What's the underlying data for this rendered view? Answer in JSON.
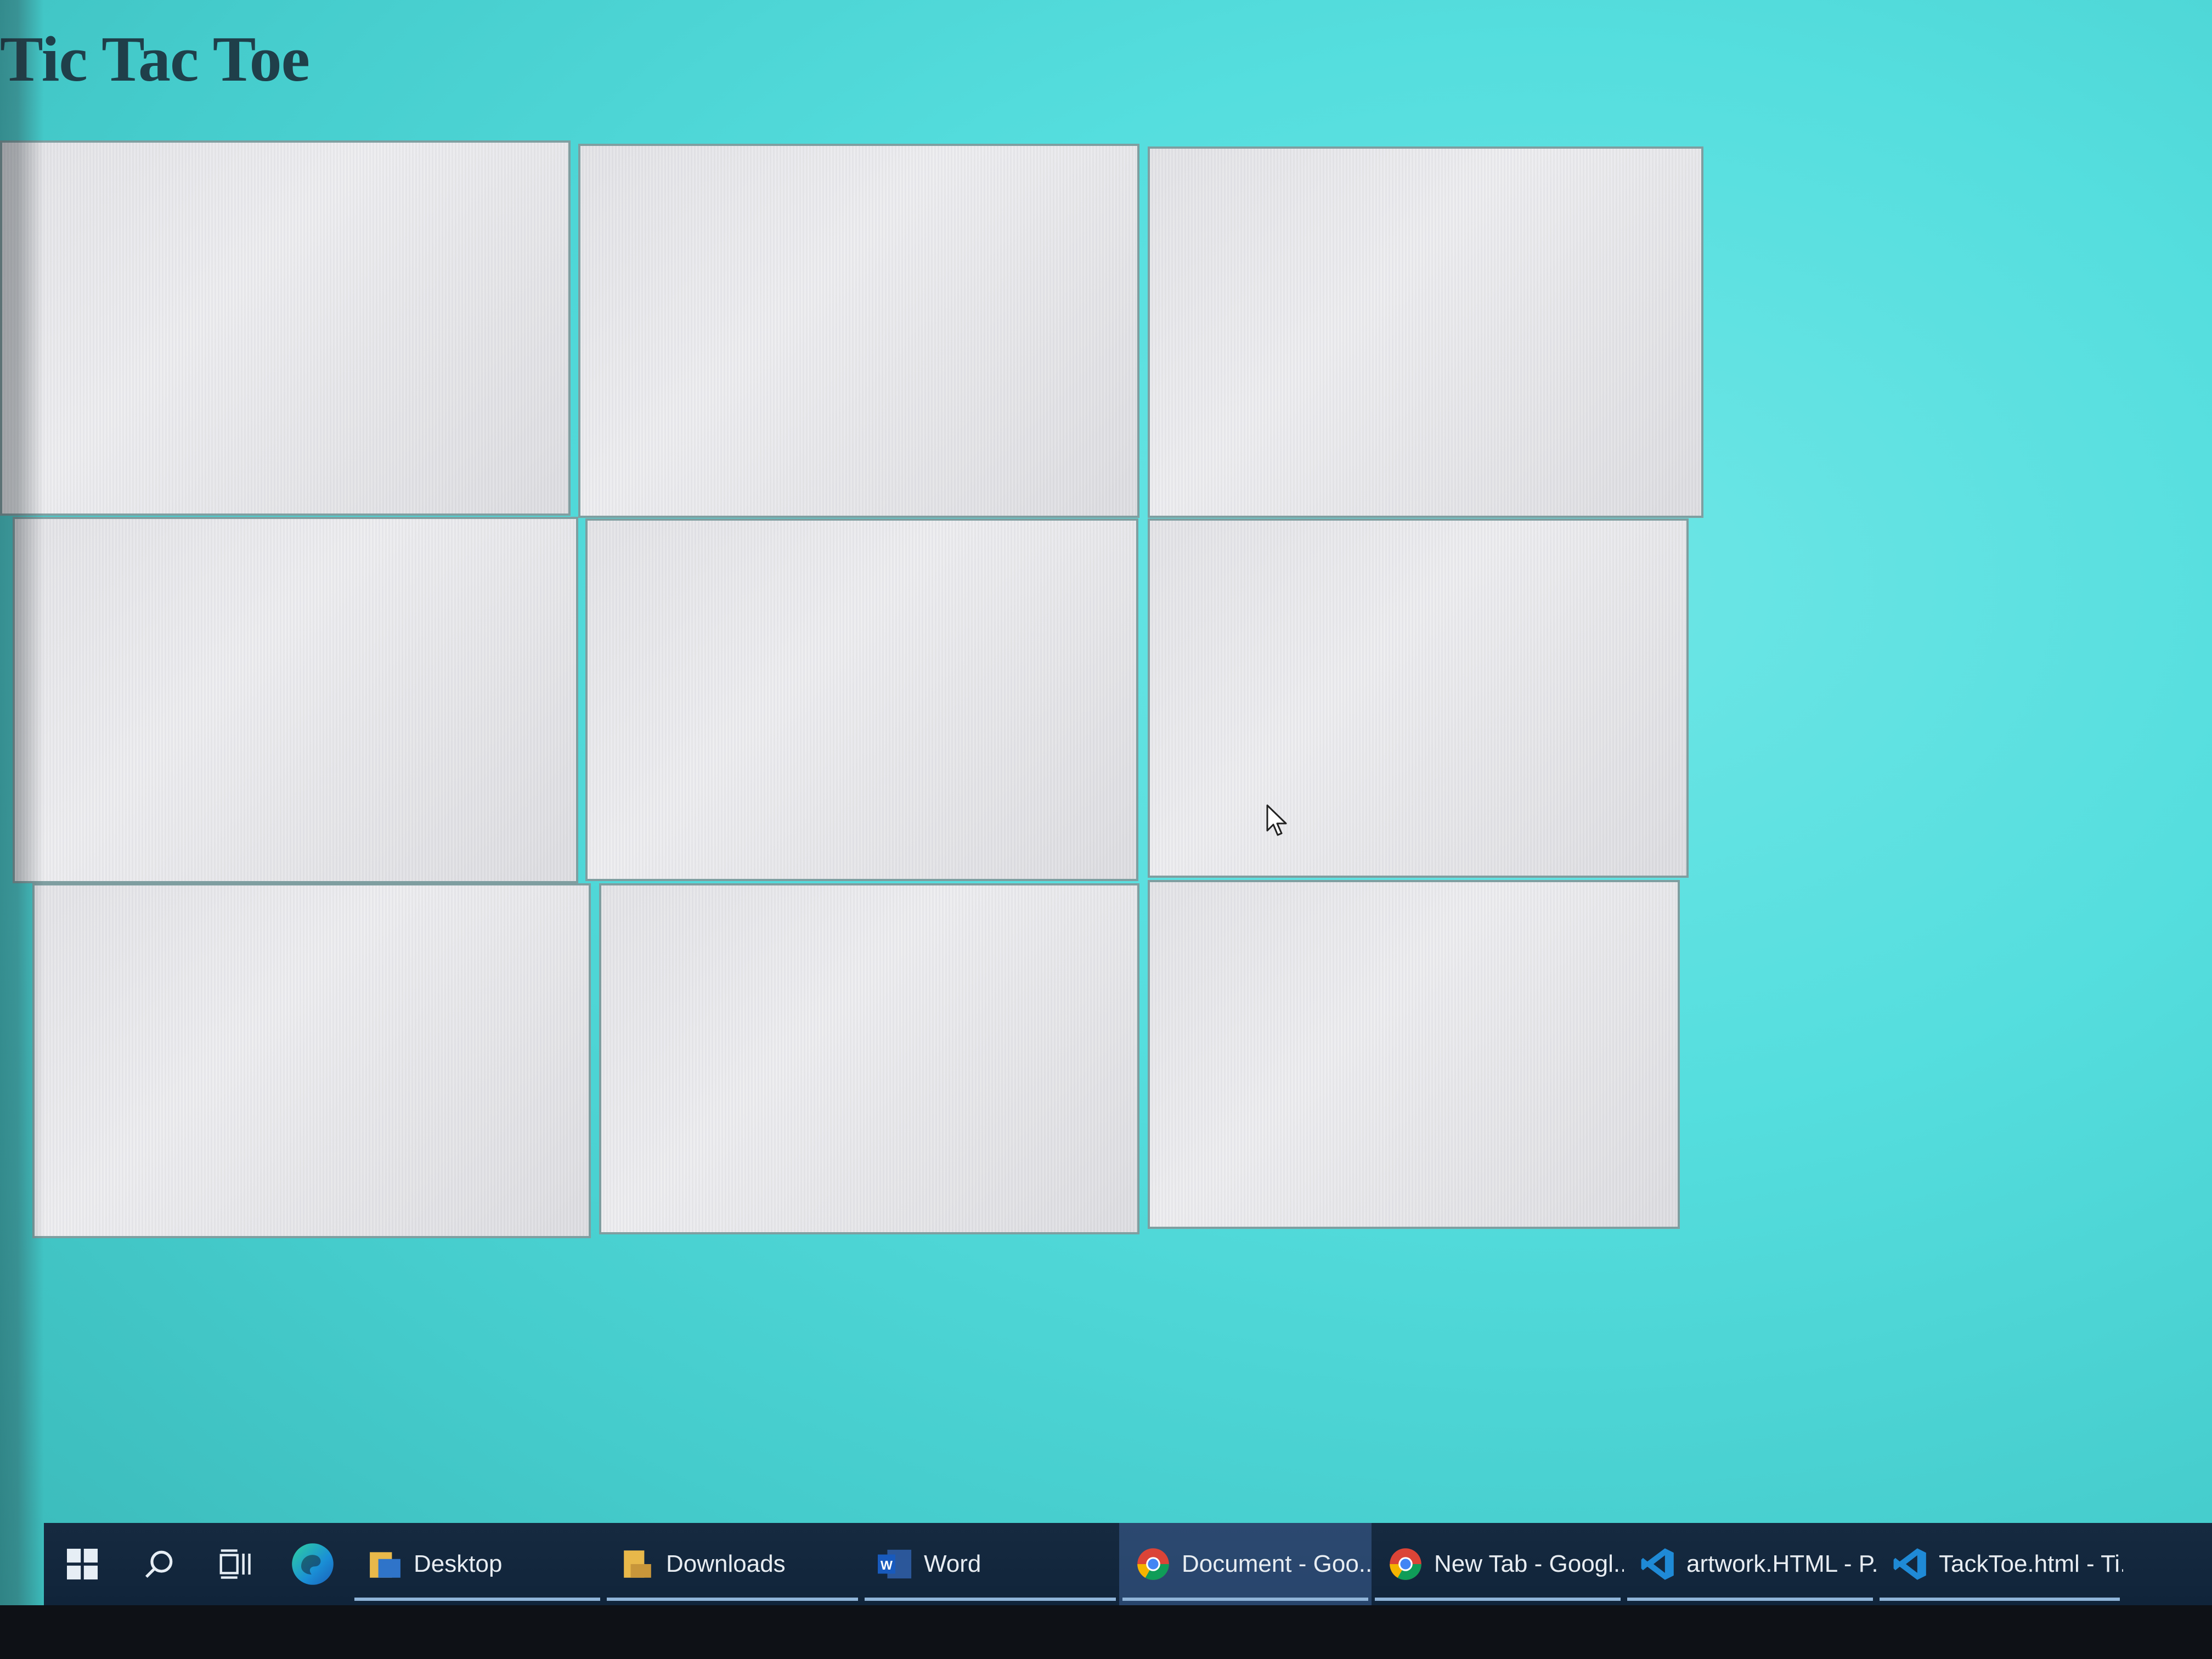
{
  "page": {
    "title": "Tic Tac Toe"
  },
  "board": {
    "cells": [
      "",
      "",
      "",
      "",
      "",
      "",
      "",
      "",
      ""
    ]
  },
  "taskbar": {
    "icons": [
      "windows-start-icon",
      "search-icon",
      "task-view-icon",
      "edge-icon"
    ],
    "apps": [
      {
        "label": "Desktop",
        "icon": "folder-icon"
      },
      {
        "label": "Downloads",
        "icon": "folder-icon"
      },
      {
        "label": "Word",
        "icon": "word-icon"
      },
      {
        "label": "Document - Goo...",
        "icon": "chrome-icon",
        "active": true
      },
      {
        "label": "New Tab - Googl...",
        "icon": "chrome-icon"
      },
      {
        "label": "artwork.HTML - P...",
        "icon": "vscode-icon"
      },
      {
        "label": "TackToe.html - Ti...",
        "icon": "vscode-icon"
      }
    ]
  },
  "colors": {
    "background": "#55dede",
    "cell": "#e6e6ea",
    "title": "#1f3f4a",
    "taskbar": "#13273d"
  }
}
